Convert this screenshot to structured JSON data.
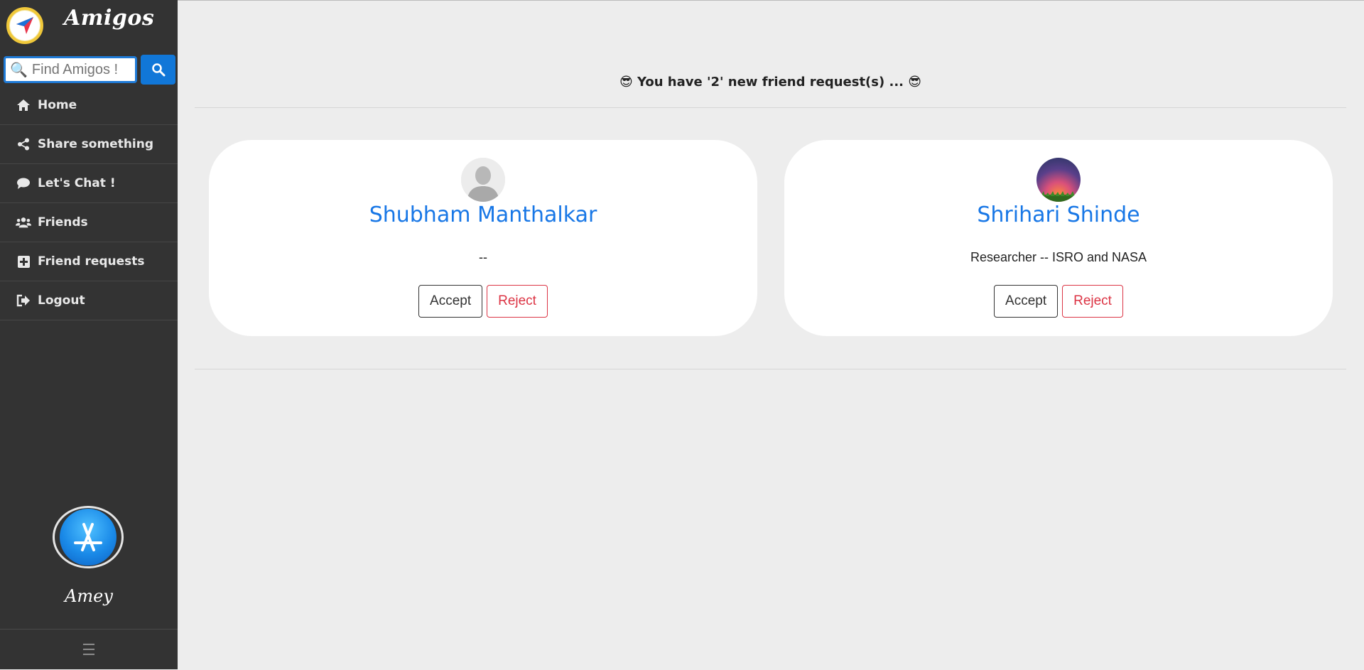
{
  "app": {
    "name": "Amigos"
  },
  "search": {
    "placeholder": "Find Amigos !"
  },
  "sidebar": {
    "items": [
      {
        "label": "Home",
        "icon": "home-icon"
      },
      {
        "label": "Share something",
        "icon": "share-icon"
      },
      {
        "label": "Let's Chat !",
        "icon": "chat-bubble-icon"
      },
      {
        "label": "Friends",
        "icon": "users-icon"
      },
      {
        "label": "Friend requests",
        "icon": "plus-square-icon"
      },
      {
        "label": "Logout",
        "icon": "sign-out-icon"
      }
    ],
    "profile_name": "Amey"
  },
  "main": {
    "heading": "😎 You have '2' new friend request(s) ... 😎",
    "requests": [
      {
        "name": "Shubham Manthalkar",
        "bio": "--",
        "accept_label": "Accept",
        "reject_label": "Reject"
      },
      {
        "name": "Shrihari Shinde",
        "bio": "Researcher -- ISRO and NASA",
        "accept_label": "Accept",
        "reject_label": "Reject"
      }
    ]
  },
  "colors": {
    "sidebar_bg": "#333333",
    "accent": "#1877e6",
    "reject": "#dc3545",
    "page_bg": "#ededed"
  }
}
